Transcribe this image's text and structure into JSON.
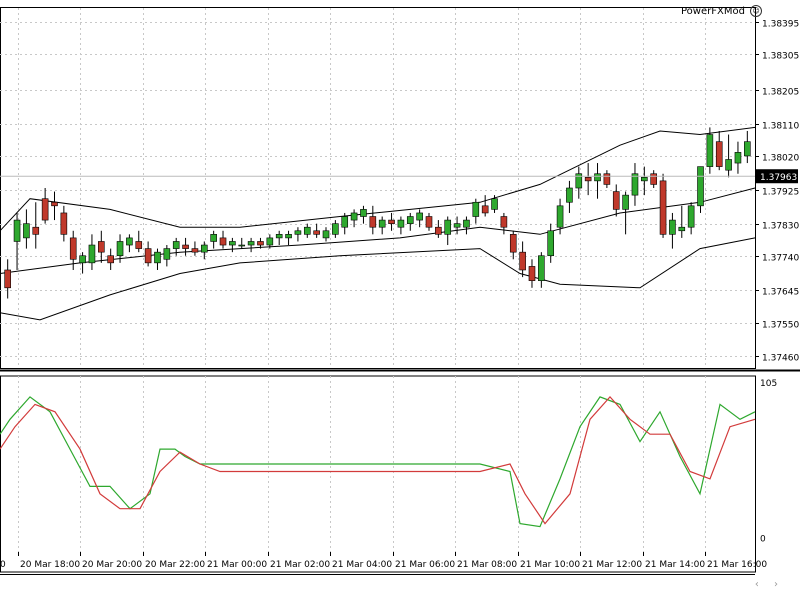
{
  "brand": {
    "label": "PowerFXMod",
    "icon": "smiley-icon"
  },
  "nav": {
    "left": "‹",
    "right": "›"
  },
  "chart_data": [
    {
      "type": "candlestick",
      "title": "",
      "indicators": [
        "Bollinger Bands",
        "Moving Average"
      ],
      "grid": true,
      "price_axis": {
        "labels": [
          "1.38395",
          "1.38305",
          "1.38205",
          "1.38110",
          "1.38020",
          "1.37925",
          "1.37830",
          "1.37740",
          "1.37645",
          "1.37550",
          "1.37460"
        ],
        "ylim": [
          1.37425,
          1.38435
        ]
      },
      "current_price": "1.37963",
      "candles": [
        [
          1.377,
          1.3773,
          1.3762,
          1.3765
        ],
        [
          1.3778,
          1.3786,
          1.377,
          1.3784
        ],
        [
          1.3779,
          1.3787,
          1.3776,
          1.3783
        ],
        [
          1.3782,
          1.3789,
          1.3776,
          1.378
        ],
        [
          1.379,
          1.3793,
          1.3783,
          1.3784
        ],
        [
          1.3789,
          1.3792,
          1.3784,
          1.3788
        ],
        [
          1.3786,
          1.3788,
          1.3778,
          1.378
        ],
        [
          1.3779,
          1.3781,
          1.377,
          1.3773
        ],
        [
          1.3772,
          1.3775,
          1.3769,
          1.3774
        ],
        [
          1.3772,
          1.378,
          1.377,
          1.3777
        ],
        [
          1.3778,
          1.3781,
          1.3772,
          1.3775
        ],
        [
          1.3774,
          1.3776,
          1.377,
          1.3772
        ],
        [
          1.3774,
          1.378,
          1.3772,
          1.3778
        ],
        [
          1.3777,
          1.378,
          1.3775,
          1.3779
        ],
        [
          1.3778,
          1.3781,
          1.3775,
          1.3776
        ],
        [
          1.3776,
          1.3778,
          1.3771,
          1.3772
        ],
        [
          1.3772,
          1.3776,
          1.377,
          1.3775
        ],
        [
          1.3773,
          1.3777,
          1.3771,
          1.3776
        ],
        [
          1.3776,
          1.3779,
          1.3774,
          1.3778
        ],
        [
          1.3777,
          1.3779,
          1.3774,
          1.3776
        ],
        [
          1.3776,
          1.3778,
          1.3774,
          1.3775
        ],
        [
          1.3775,
          1.3778,
          1.3773,
          1.3777
        ],
        [
          1.3778,
          1.3781,
          1.3776,
          1.378
        ],
        [
          1.3779,
          1.3781,
          1.3776,
          1.3777
        ],
        [
          1.3777,
          1.3779,
          1.3775,
          1.3778
        ],
        [
          1.3777,
          1.3779,
          1.3776,
          1.3777
        ],
        [
          1.3777,
          1.3779,
          1.3775,
          1.3778
        ],
        [
          1.3778,
          1.3779,
          1.3776,
          1.3777
        ],
        [
          1.3777,
          1.378,
          1.3776,
          1.3779
        ],
        [
          1.3779,
          1.3781,
          1.3777,
          1.378
        ],
        [
          1.3779,
          1.3781,
          1.3777,
          1.378
        ],
        [
          1.378,
          1.3782,
          1.3778,
          1.3781
        ],
        [
          1.378,
          1.3783,
          1.3779,
          1.3782
        ],
        [
          1.3781,
          1.3783,
          1.3779,
          1.378
        ],
        [
          1.3779,
          1.3782,
          1.3778,
          1.3781
        ],
        [
          1.378,
          1.3784,
          1.3779,
          1.3783
        ],
        [
          1.3782,
          1.3786,
          1.378,
          1.3785
        ],
        [
          1.3784,
          1.3787,
          1.3782,
          1.3786
        ],
        [
          1.3785,
          1.3788,
          1.3783,
          1.3787
        ],
        [
          1.3785,
          1.3788,
          1.378,
          1.3782
        ],
        [
          1.3782,
          1.3785,
          1.378,
          1.3784
        ],
        [
          1.3784,
          1.3786,
          1.3781,
          1.3783
        ],
        [
          1.3782,
          1.3785,
          1.378,
          1.3784
        ],
        [
          1.3783,
          1.3786,
          1.3781,
          1.3785
        ],
        [
          1.3784,
          1.3787,
          1.3782,
          1.3786
        ],
        [
          1.3785,
          1.3786,
          1.3781,
          1.3782
        ],
        [
          1.3782,
          1.3784,
          1.3779,
          1.378
        ],
        [
          1.378,
          1.3785,
          1.3777,
          1.3784
        ],
        [
          1.3782,
          1.3785,
          1.378,
          1.3783
        ],
        [
          1.3782,
          1.3785,
          1.378,
          1.3784
        ],
        [
          1.3785,
          1.379,
          1.3783,
          1.3789
        ],
        [
          1.3788,
          1.3791,
          1.3785,
          1.3786
        ],
        [
          1.3787,
          1.3791,
          1.3786,
          1.379
        ],
        [
          1.3785,
          1.3786,
          1.378,
          1.3782
        ],
        [
          1.378,
          1.3781,
          1.3773,
          1.3775
        ],
        [
          1.3775,
          1.3778,
          1.3768,
          1.377
        ],
        [
          1.3771,
          1.3773,
          1.3765,
          1.3767
        ],
        [
          1.3767,
          1.3775,
          1.3765,
          1.3774
        ],
        [
          1.3774,
          1.3783,
          1.3772,
          1.3781
        ],
        [
          1.3782,
          1.379,
          1.378,
          1.3788
        ],
        [
          1.3789,
          1.3795,
          1.3786,
          1.3793
        ],
        [
          1.3793,
          1.3799,
          1.379,
          1.3797
        ],
        [
          1.3796,
          1.38,
          1.3791,
          1.3795
        ],
        [
          1.3795,
          1.38,
          1.379,
          1.3797
        ],
        [
          1.3797,
          1.3798,
          1.3793,
          1.3794
        ],
        [
          1.3792,
          1.3794,
          1.3785,
          1.3787
        ],
        [
          1.3787,
          1.3792,
          1.378,
          1.3791
        ],
        [
          1.3791,
          1.38,
          1.3788,
          1.3797
        ],
        [
          1.3795,
          1.3799,
          1.3791,
          1.3796
        ],
        [
          1.3797,
          1.3798,
          1.3793,
          1.3794
        ],
        [
          1.3795,
          1.3797,
          1.3779,
          1.378
        ],
        [
          1.378,
          1.3786,
          1.3776,
          1.3784
        ],
        [
          1.3781,
          1.3788,
          1.3779,
          1.3782
        ],
        [
          1.3782,
          1.3789,
          1.378,
          1.3788
        ],
        [
          1.3788,
          1.3799,
          1.3786,
          1.3799
        ],
        [
          1.3799,
          1.381,
          1.3797,
          1.3808
        ],
        [
          1.3806,
          1.3809,
          1.3798,
          1.3799
        ],
        [
          1.3798,
          1.3808,
          1.3796,
          1.3801
        ],
        [
          1.38,
          1.3806,
          1.3797,
          1.3803
        ],
        [
          1.3802,
          1.3809,
          1.38,
          1.3806
        ]
      ],
      "bollinger": {
        "upper": [
          [
            0,
            1.3781
          ],
          [
            30,
            1.379
          ],
          [
            110,
            1.3787
          ],
          [
            180,
            1.3782
          ],
          [
            240,
            1.3782
          ],
          [
            340,
            1.3785
          ],
          [
            480,
            1.3789
          ],
          [
            540,
            1.3794
          ],
          [
            620,
            1.3805
          ],
          [
            660,
            1.3809
          ],
          [
            700,
            1.3808
          ],
          [
            755,
            1.381
          ]
        ],
        "middle": [
          [
            0,
            1.3769
          ],
          [
            80,
            1.3772
          ],
          [
            180,
            1.3775
          ],
          [
            300,
            1.3777
          ],
          [
            400,
            1.3779
          ],
          [
            480,
            1.3782
          ],
          [
            540,
            1.378
          ],
          [
            620,
            1.3786
          ],
          [
            700,
            1.3789
          ],
          [
            755,
            1.3793
          ]
        ],
        "lower": [
          [
            0,
            1.3758
          ],
          [
            40,
            1.3756
          ],
          [
            110,
            1.3763
          ],
          [
            180,
            1.3769
          ],
          [
            240,
            1.3772
          ],
          [
            340,
            1.3774
          ],
          [
            480,
            1.3776
          ],
          [
            520,
            1.3769
          ],
          [
            560,
            1.3766
          ],
          [
            640,
            1.3765
          ],
          [
            700,
            1.3776
          ],
          [
            755,
            1.3779
          ]
        ]
      },
      "time_axis": [
        "20 Mar 18:00",
        "20 Mar 20:00",
        "20 Mar 22:00",
        "21 Mar 00:00",
        "21 Mar 02:00",
        "21 Mar 04:00",
        "21 Mar 06:00",
        "21 Mar 08:00",
        "21 Mar 10:00",
        "21 Mar 12:00",
        "21 Mar 14:00",
        "21 Mar 16:00"
      ],
      "time_axis_partial": "0"
    },
    {
      "type": "line",
      "title": "",
      "oscillator_axis": {
        "labels": [
          "105",
          "0"
        ],
        "ylim": [
          -5,
          105
        ]
      },
      "series": [
        {
          "color": "#2ea82e",
          "values": [
            [
              0,
              70
            ],
            [
              10,
              80
            ],
            [
              30,
              95
            ],
            [
              50,
              85
            ],
            [
              70,
              60
            ],
            [
              90,
              35
            ],
            [
              110,
              35
            ],
            [
              130,
              20
            ],
            [
              150,
              30
            ],
            [
              160,
              60
            ],
            [
              175,
              60
            ],
            [
              185,
              55
            ],
            [
              200,
              50
            ],
            [
              220,
              50
            ],
            [
              240,
              50
            ],
            [
              300,
              50
            ],
            [
              360,
              50
            ],
            [
              420,
              50
            ],
            [
              480,
              50
            ],
            [
              510,
              45
            ],
            [
              520,
              10
            ],
            [
              540,
              8
            ],
            [
              560,
              40
            ],
            [
              580,
              75
            ],
            [
              600,
              95
            ],
            [
              620,
              90
            ],
            [
              640,
              65
            ],
            [
              660,
              85
            ],
            [
              680,
              55
            ],
            [
              700,
              30
            ],
            [
              720,
              90
            ],
            [
              740,
              80
            ],
            [
              755,
              85
            ]
          ]
        },
        {
          "color": "#d23b3b",
          "values": [
            [
              0,
              60
            ],
            [
              15,
              75
            ],
            [
              35,
              90
            ],
            [
              55,
              85
            ],
            [
              80,
              60
            ],
            [
              100,
              30
            ],
            [
              120,
              20
            ],
            [
              140,
              20
            ],
            [
              160,
              45
            ],
            [
              180,
              58
            ],
            [
              200,
              50
            ],
            [
              220,
              45
            ],
            [
              240,
              45
            ],
            [
              300,
              45
            ],
            [
              360,
              45
            ],
            [
              420,
              45
            ],
            [
              480,
              45
            ],
            [
              510,
              50
            ],
            [
              525,
              30
            ],
            [
              545,
              10
            ],
            [
              570,
              30
            ],
            [
              590,
              80
            ],
            [
              610,
              95
            ],
            [
              630,
              80
            ],
            [
              650,
              70
            ],
            [
              670,
              70
            ],
            [
              690,
              45
            ],
            [
              710,
              40
            ],
            [
              730,
              75
            ],
            [
              755,
              80
            ]
          ]
        }
      ]
    }
  ]
}
